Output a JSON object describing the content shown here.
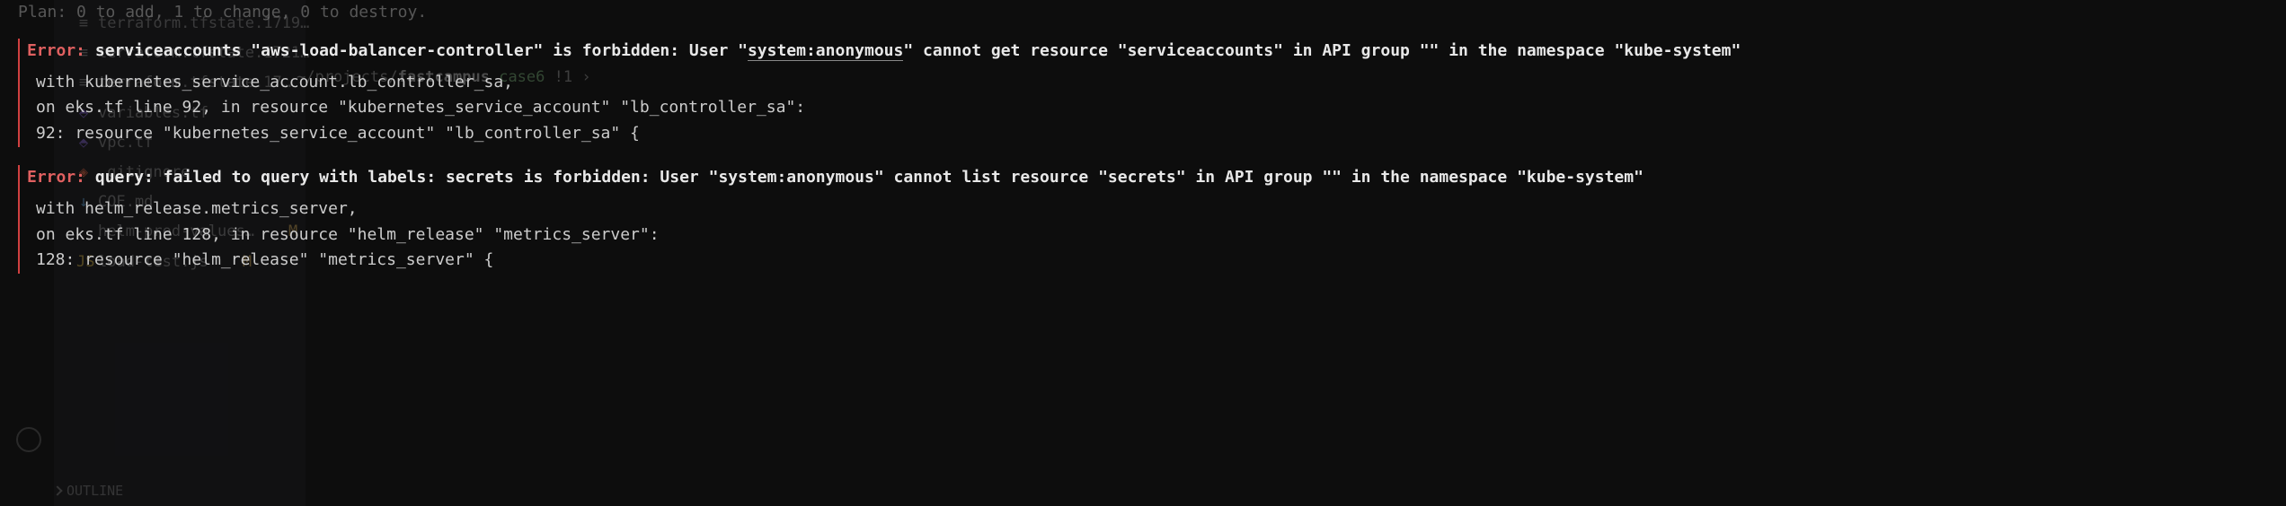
{
  "plan_line": "Plan: 0 to add, 1 to change, 0 to destroy.",
  "errors": [
    {
      "label": "Error:",
      "message_pre": "serviceaccounts \"aws-load-balancer-controller\" is forbidden: User \"",
      "message_underlined": "system:anonymous",
      "message_post": "\" cannot get resource \"serviceaccounts\" in API group \"\" in the namespace \"kube-system\"",
      "context": [
        "  with kubernetes_service_account.lb_controller_sa,",
        "  on eks.tf line 92, in resource \"kubernetes_service_account\" \"lb_controller_sa\":",
        "  92: resource \"kubernetes_service_account\" \"lb_controller_sa\" {"
      ]
    },
    {
      "label": "Error:",
      "message_pre": "query: failed to query with labels: secrets is forbidden: User \"system:anonymous\" cannot list resource \"secrets\" in API group \"\" in the namespace \"kube-system\"",
      "message_underlined": "",
      "message_post": "",
      "context": [
        "  with helm_release.metrics_server,",
        "  on eks.tf line 128, in resource \"helm_release\" \"metrics_server\":",
        " 128: resource \"helm_release\" \"metrics_server\" {"
      ]
    }
  ],
  "file_tree": {
    "items": [
      {
        "icon": "≡",
        "name": "terraform.tfstate.1719…",
        "icon_class": ""
      },
      {
        "icon": "≡",
        "name": "terraform.tfstate.1721…",
        "icon_class": ""
      },
      {
        "icon": "≡",
        "name": "terraform.tfstate.17…",
        "icon_class": ""
      },
      {
        "icon": "⬘",
        "name": "variables.tf",
        "icon_class": "tf-icon"
      },
      {
        "icon": "⬘",
        "name": "vpc.tf",
        "icon_class": "tf-icon"
      },
      {
        "icon": "◈",
        "name": ".gitignore",
        "icon_class": "git-icon"
      },
      {
        "icon": "↓",
        "name": "COE.md",
        "icon_class": "md-icon"
      },
      {
        "icon": "",
        "name": "helm-prod-values…",
        "icon_class": "",
        "modified": "M"
      },
      {
        "icon": "JS",
        "name": "load-test.js",
        "icon_class": "js-icon",
        "modified": "M"
      }
    ]
  },
  "path_bar": {
    "prefix": "~/projects/",
    "bold": "fastcampus",
    "branch": "case6",
    "suffix": " !1 ›"
  },
  "outline_label": "OUTLINE"
}
